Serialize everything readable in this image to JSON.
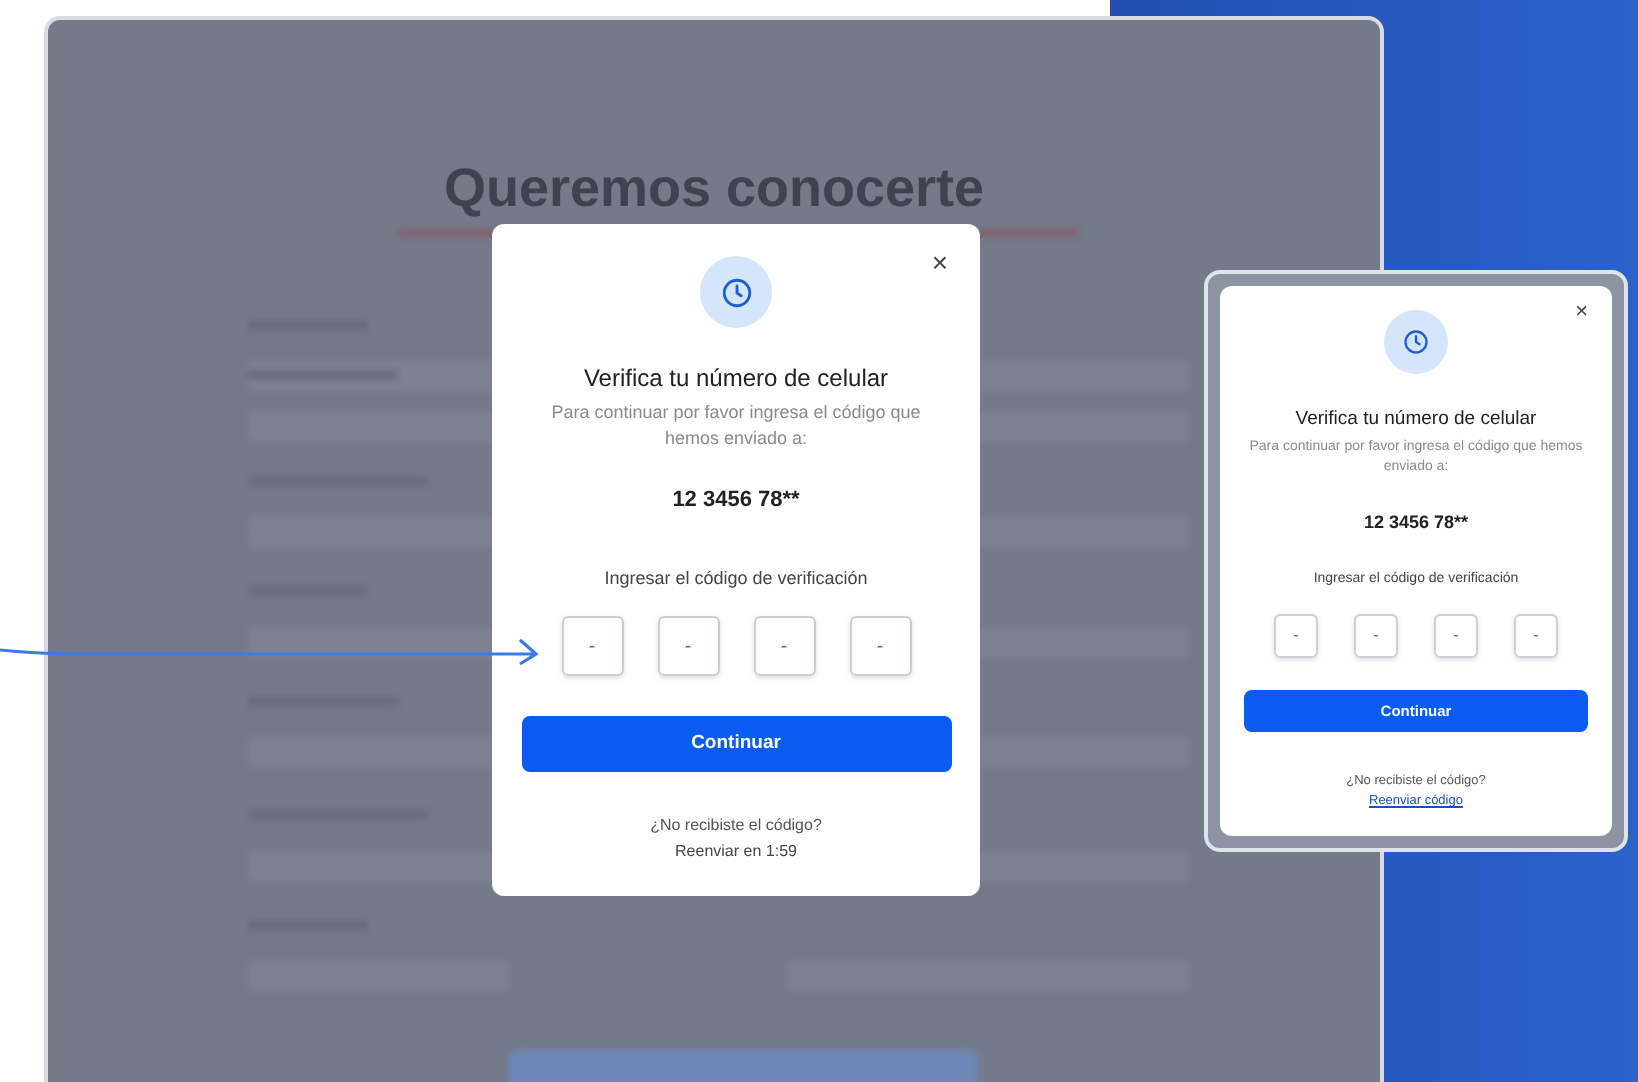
{
  "backdrop": {
    "title": "Queremos conocerte"
  },
  "modal": {
    "close": "×",
    "title": "Verifica tu número de celular",
    "description": "Para continuar por favor ingresa el código que hemos enviado a:",
    "phone": "12 3456 78**",
    "code_label": "Ingresar el código de verificación",
    "code_inputs": [
      "-",
      "-",
      "-",
      "-"
    ],
    "button": "Continuar",
    "resend_question": "¿No recibiste el código?",
    "resend": {
      "kind": "timer",
      "text": "Reenviar en 1:59"
    }
  },
  "preview": {
    "close": "×",
    "title": "Verifica tu número de celular",
    "description": "Para continuar por favor ingresa el código que hemos enviado a:",
    "phone": "12 3456 78**",
    "code_label": "Ingresar el código de verificación",
    "code_inputs": [
      "-",
      "-",
      "-",
      "-"
    ],
    "button": "Continuar",
    "resend_question": "¿No recibiste el código?",
    "resend": {
      "kind": "link",
      "text": "Reenviar código"
    }
  }
}
